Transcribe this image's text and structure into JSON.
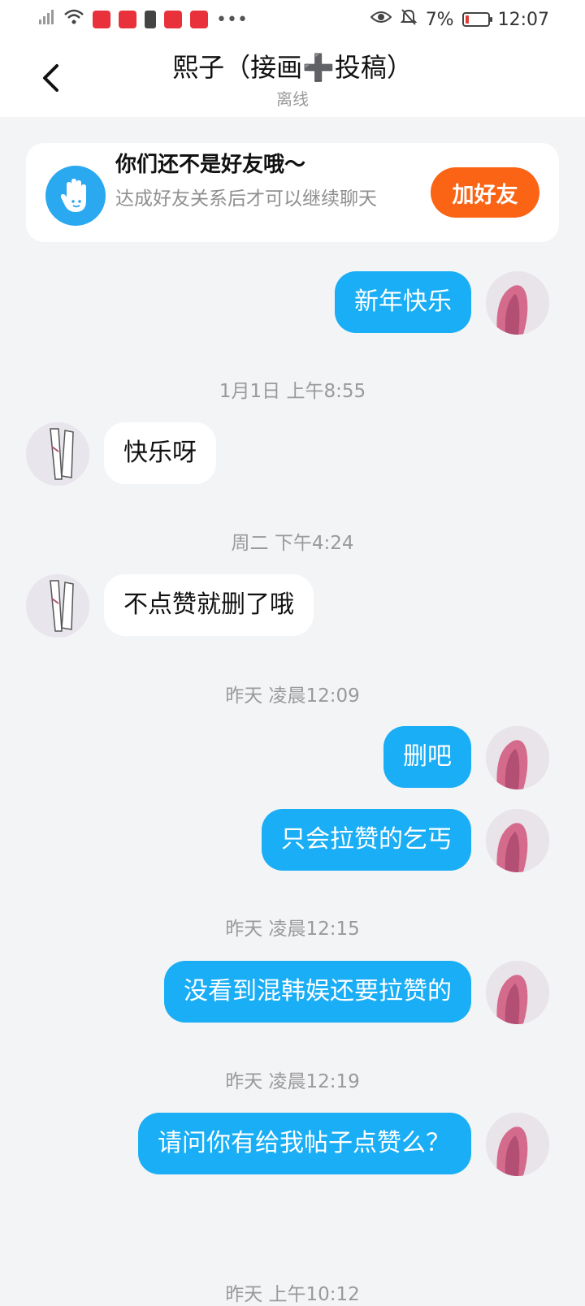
{
  "status_bar": {
    "battery_percent": "7%",
    "time": "12:07"
  },
  "header": {
    "title": "熙子（接画➕投稿）",
    "subtitle": "离线"
  },
  "friend_notice": {
    "title": "你们还不是好友哦～",
    "description": "达成好友关系后才可以继续聊天",
    "button_label": "加好友"
  },
  "messages": [
    {
      "type": "out",
      "text": "新年快乐"
    },
    {
      "type": "timestamp",
      "text": "1月1日 上午8:55"
    },
    {
      "type": "in",
      "text": "快乐呀"
    },
    {
      "type": "timestamp",
      "text": "周二 下午4:24"
    },
    {
      "type": "in",
      "text": "不点赞就删了哦"
    },
    {
      "type": "timestamp",
      "text": "昨天 凌晨12:09"
    },
    {
      "type": "out",
      "text": "删吧"
    },
    {
      "type": "out",
      "text": "只会拉赞的乞丐"
    },
    {
      "type": "timestamp",
      "text": "昨天 凌晨12:15"
    },
    {
      "type": "out",
      "text": "没看到混韩娱还要拉赞的"
    },
    {
      "type": "timestamp",
      "text": "昨天 凌晨12:19"
    },
    {
      "type": "out",
      "text": "请问你有给我帖子点赞么？"
    },
    {
      "type": "timestamp",
      "text": "昨天 上午10:12"
    }
  ]
}
